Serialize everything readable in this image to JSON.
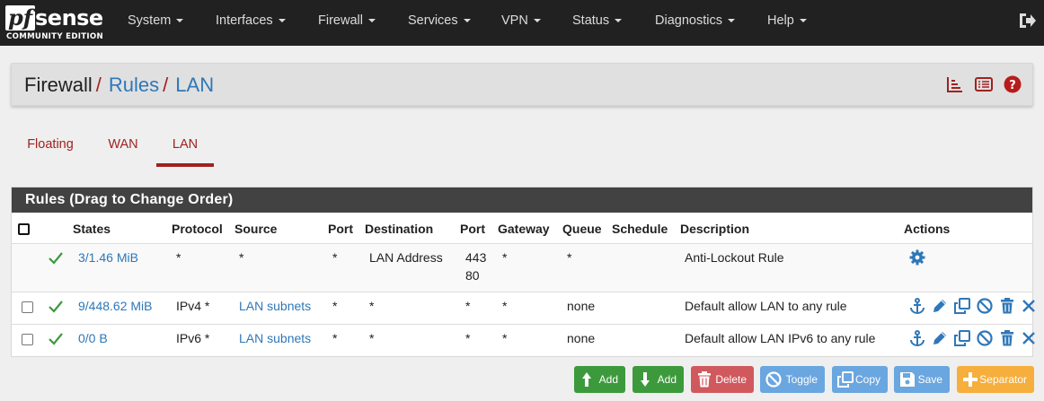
{
  "logo": {
    "brand_prefix": "pf",
    "brand_name": "sense",
    "edition": "COMMUNITY EDITION"
  },
  "nav": {
    "items": [
      "System",
      "Interfaces",
      "Firewall",
      "Services",
      "VPN",
      "Status",
      "Diagnostics",
      "Help"
    ],
    "logout_icon": "sign-out-icon"
  },
  "breadcrumb": {
    "parts": [
      "Firewall",
      "Rules",
      "LAN"
    ],
    "separator": "/",
    "icons": [
      "bar-chart-icon",
      "list-icon",
      "help-circle-icon"
    ]
  },
  "tabs": [
    {
      "label": "Floating",
      "active": false
    },
    {
      "label": "WAN",
      "active": false
    },
    {
      "label": "LAN",
      "active": true
    }
  ],
  "rules": {
    "title": "Rules (Drag to Change Order)",
    "columns": [
      "States",
      "Protocol",
      "Source",
      "Port",
      "Destination",
      "Port",
      "Gateway",
      "Queue",
      "Schedule",
      "Description",
      "Actions"
    ],
    "rows": [
      {
        "has_checkbox": false,
        "enabled": true,
        "states": "3/1.46 MiB",
        "protocol": "*",
        "source": "*",
        "source_port": "*",
        "destination": "LAN Address",
        "dest_port_1": "443",
        "dest_port_2": "80",
        "gateway": "*",
        "queue": "*",
        "schedule": "",
        "description": "Anti-Lockout Rule",
        "actions": [
          "gear-icon"
        ]
      },
      {
        "has_checkbox": true,
        "enabled": true,
        "states": "9/448.62 MiB",
        "protocol": "IPv4 *",
        "source": "LAN subnets",
        "source_port": "*",
        "destination": "*",
        "dest_port_1": "*",
        "dest_port_2": "",
        "gateway": "*",
        "queue": "none",
        "schedule": "",
        "description": "Default allow LAN to any rule",
        "actions": [
          "anchor-icon",
          "pencil-icon",
          "copy-icon",
          "ban-icon",
          "trash-icon",
          "close-icon"
        ]
      },
      {
        "has_checkbox": true,
        "enabled": true,
        "states": "0/0 B",
        "protocol": "IPv6 *",
        "source": "LAN subnets",
        "source_port": "*",
        "destination": "*",
        "dest_port_1": "*",
        "dest_port_2": "",
        "gateway": "*",
        "queue": "none",
        "schedule": "",
        "description": "Default allow LAN IPv6 to any rule",
        "actions": [
          "anchor-icon",
          "pencil-icon",
          "copy-icon",
          "ban-icon",
          "trash-icon",
          "close-icon"
        ]
      }
    ]
  },
  "buttons": [
    {
      "label": "Add",
      "icon": "arrow-up-icon",
      "color": "#3c9a3c"
    },
    {
      "label": "Add",
      "icon": "arrow-down-icon",
      "color": "#3c9a3c"
    },
    {
      "label": "Delete",
      "icon": "trash-icon",
      "color": "#d0595e"
    },
    {
      "label": "Toggle",
      "icon": "ban-icon",
      "color": "#6aa6e0"
    },
    {
      "label": "Copy",
      "icon": "copy-icon",
      "color": "#6aa6e0"
    },
    {
      "label": "Save",
      "icon": "save-icon",
      "color": "#6aa6e0"
    },
    {
      "label": "Separator",
      "icon": "plus-icon",
      "color": "#f6ae3d"
    }
  ],
  "colors": {
    "navbar": "#212121",
    "accent_red": "#a12121",
    "link_blue": "#2f77b8",
    "enabled_green": "#3c9a3c",
    "panel_header": "#424242"
  }
}
